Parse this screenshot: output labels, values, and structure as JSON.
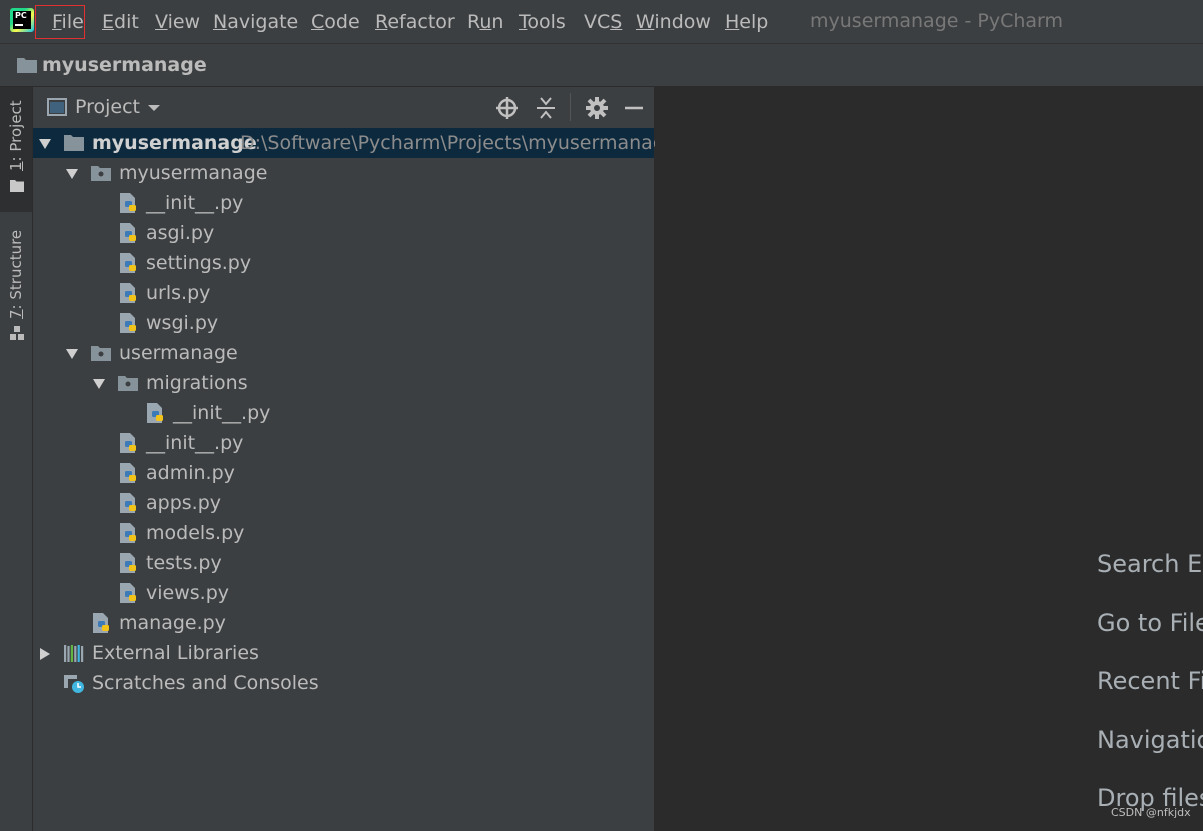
{
  "menu": {
    "items": [
      {
        "pre": "",
        "mnemonic": "F",
        "post": "ile"
      },
      {
        "pre": "",
        "mnemonic": "E",
        "post": "dit"
      },
      {
        "pre": "",
        "mnemonic": "V",
        "post": "iew"
      },
      {
        "pre": "",
        "mnemonic": "N",
        "post": "avigate"
      },
      {
        "pre": "",
        "mnemonic": "C",
        "post": "ode"
      },
      {
        "pre": "",
        "mnemonic": "R",
        "post": "efactor"
      },
      {
        "pre": "R",
        "mnemonic": "u",
        "post": "n"
      },
      {
        "pre": "",
        "mnemonic": "T",
        "post": "ools"
      },
      {
        "pre": "VC",
        "mnemonic": "S",
        "post": ""
      },
      {
        "pre": "",
        "mnemonic": "W",
        "post": "indow"
      },
      {
        "pre": "",
        "mnemonic": "H",
        "post": "elp"
      }
    ],
    "window_title": "myusermanage - PyCharm"
  },
  "navbar": {
    "project": "myusermanage"
  },
  "stripe": {
    "tabs": [
      {
        "mnemonic": "1",
        "label": ": Project"
      },
      {
        "mnemonic": "7",
        "label": ": Structure"
      }
    ]
  },
  "panel": {
    "title": "Project"
  },
  "tree": [
    {
      "label": "myusermanage",
      "path": "D:\\Software\\Pycharm\\Projects\\myusermanage",
      "kind": "root",
      "level": 0,
      "expanded": true,
      "selected": true
    },
    {
      "label": "myusermanage",
      "kind": "package",
      "level": 1,
      "expanded": true
    },
    {
      "label": "__init__.py",
      "kind": "py",
      "level": 2
    },
    {
      "label": "asgi.py",
      "kind": "py",
      "level": 2
    },
    {
      "label": "settings.py",
      "kind": "py",
      "level": 2
    },
    {
      "label": "urls.py",
      "kind": "py",
      "level": 2
    },
    {
      "label": "wsgi.py",
      "kind": "py",
      "level": 2
    },
    {
      "label": "usermanage",
      "kind": "package",
      "level": 1,
      "expanded": true
    },
    {
      "label": "migrations",
      "kind": "package",
      "level": 2,
      "expanded": true
    },
    {
      "label": "__init__.py",
      "kind": "py",
      "level": 3
    },
    {
      "label": "__init__.py",
      "kind": "py",
      "level": 2
    },
    {
      "label": "admin.py",
      "kind": "py",
      "level": 2
    },
    {
      "label": "apps.py",
      "kind": "py",
      "level": 2
    },
    {
      "label": "models.py",
      "kind": "py",
      "level": 2
    },
    {
      "label": "tests.py",
      "kind": "py",
      "level": 2
    },
    {
      "label": "views.py",
      "kind": "py",
      "level": 2
    },
    {
      "label": "manage.py",
      "kind": "py",
      "level": 1
    },
    {
      "label": "External Libraries",
      "kind": "libraries",
      "level": 0,
      "expanded": false
    },
    {
      "label": "Scratches and Consoles",
      "kind": "scratches",
      "level": 0
    }
  ],
  "editor": {
    "hints": [
      "Search Ev",
      "Go to File",
      "Recent Fi",
      "Navigatio",
      "Drop files"
    ]
  },
  "watermark": "CSDN @nfkjdx",
  "colors": {
    "menubar_bg": "#3c3f41",
    "editor_bg": "#2b2b2b",
    "selection_bg": "#0d293e",
    "file_highlight_border": "#e03030",
    "folder_icon": "#87939a"
  }
}
